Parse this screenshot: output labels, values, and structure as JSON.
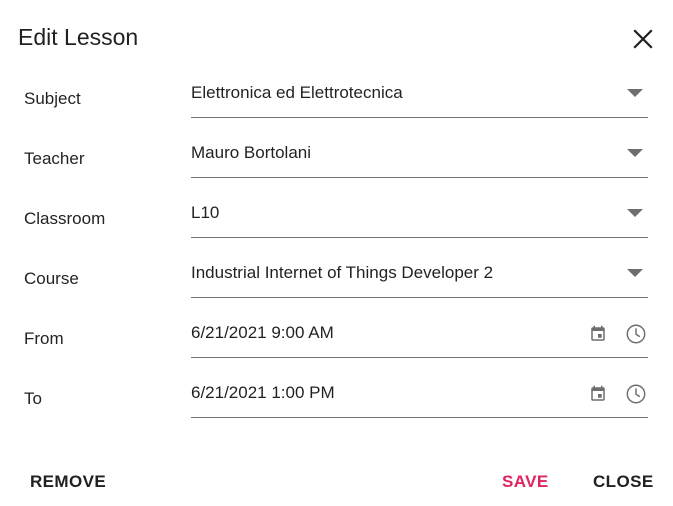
{
  "dialog": {
    "title": "Edit Lesson"
  },
  "fields": {
    "subject": {
      "label": "Subject",
      "value": "Elettronica ed Elettrotecnica"
    },
    "teacher": {
      "label": "Teacher",
      "value": "Mauro Bortolani"
    },
    "classroom": {
      "label": "Classroom",
      "value": "L10"
    },
    "course": {
      "label": "Course",
      "value": "Industrial Internet of Things Developer 2"
    },
    "from": {
      "label": "From",
      "value": "6/21/2021 9:00 AM"
    },
    "to": {
      "label": "To",
      "value": "6/21/2021 1:00 PM"
    }
  },
  "actions": {
    "remove": "REMOVE",
    "save": "SAVE",
    "close": "CLOSE"
  },
  "colors": {
    "accent": "#e0245e",
    "text": "#212121",
    "icon": "#6e6e6e"
  },
  "icons": {
    "close": "close-icon",
    "dropdown": "chevron-down-icon",
    "calendar": "calendar-icon",
    "clock": "clock-icon"
  }
}
